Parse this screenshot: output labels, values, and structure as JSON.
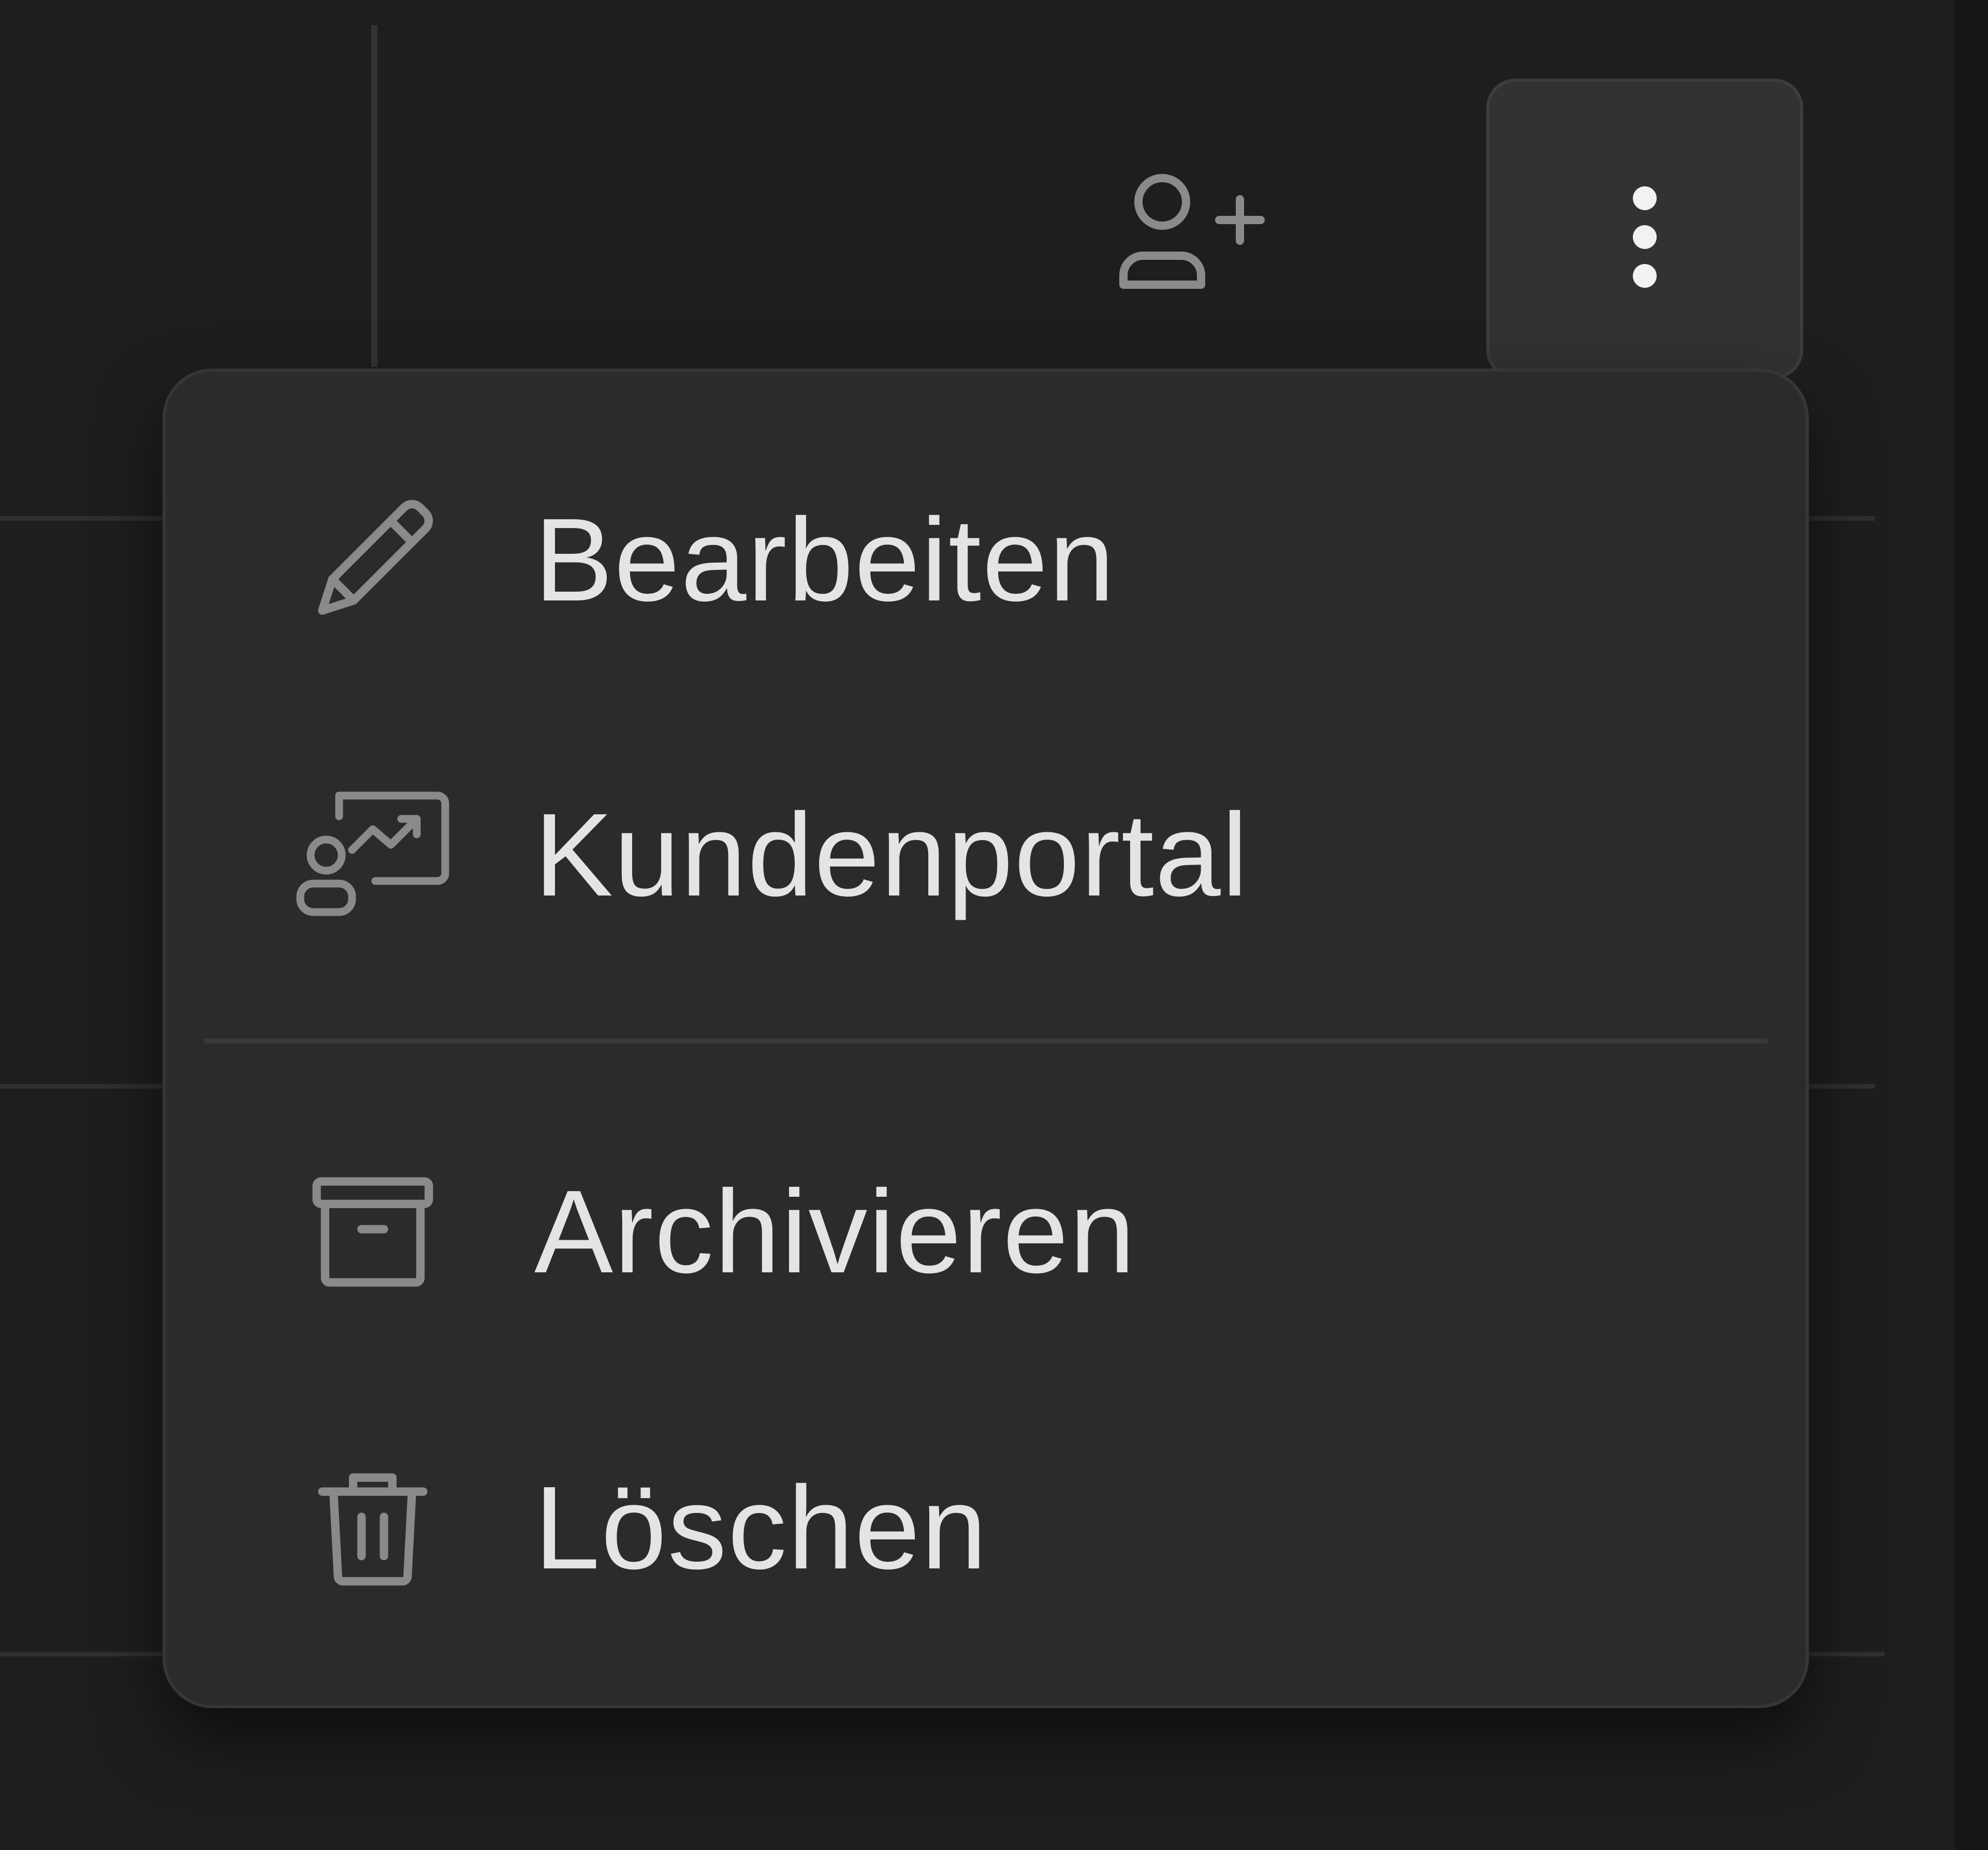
{
  "toolbar": {
    "add_user_icon": "user-plus-icon",
    "more_icon": "more-vertical-icon"
  },
  "menu": {
    "items": [
      {
        "label": "Bearbeiten",
        "icon": "pencil-icon"
      },
      {
        "label": "Kundenportal",
        "icon": "customer-portal-icon"
      },
      {
        "label": "Archivieren",
        "icon": "archive-icon"
      },
      {
        "label": "Löschen",
        "icon": "trash-icon"
      }
    ]
  },
  "colors": {
    "background": "#1e1e1e",
    "menu_background": "#2b2b2b",
    "menu_border": "#363636",
    "text": "#e4e4e4",
    "icon": "#8a8a8a",
    "button_background": "#323232"
  }
}
